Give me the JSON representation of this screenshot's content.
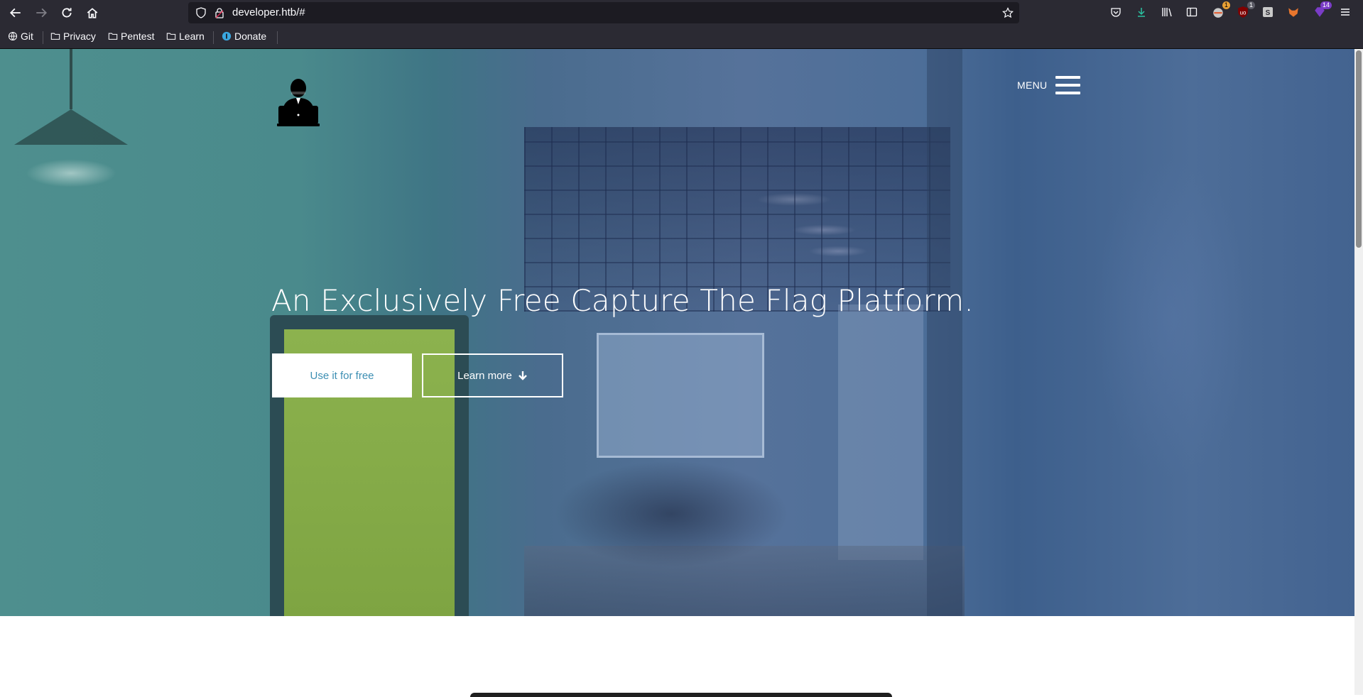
{
  "browser": {
    "url": "developer.htb/#",
    "bookmarks": [
      {
        "label": "Git",
        "icon": "globe-icon"
      },
      {
        "label": "Privacy",
        "icon": "folder-icon"
      },
      {
        "label": "Pentest",
        "icon": "folder-icon"
      },
      {
        "label": "Learn",
        "icon": "folder-icon"
      },
      {
        "label": "Donate",
        "icon": "donate-icon"
      }
    ],
    "extension_badges": {
      "ext1": "1",
      "ext2": "1",
      "ext3": "14"
    },
    "colors": {
      "chrome": "#2b2a33",
      "urlbar": "#1c1b22"
    }
  },
  "hero": {
    "menu_label": "MENU",
    "headline": "An Exclusively Free Capture The Flag Platform.",
    "primary_button": "Use it for free",
    "secondary_button": "Learn more",
    "colors": {
      "primary_text": "#3d8fb3",
      "overlay": "#4a7a95"
    }
  }
}
